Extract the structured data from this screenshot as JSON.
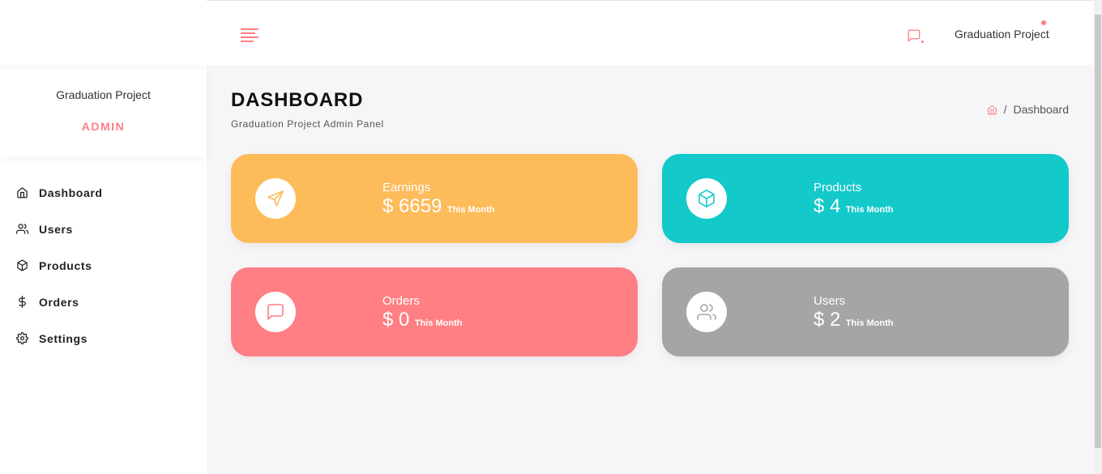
{
  "sidebar": {
    "profile_name": "Graduation Project",
    "profile_role": "ADMIN",
    "items": [
      {
        "label": "Dashboard",
        "icon": "home-icon"
      },
      {
        "label": "Users",
        "icon": "users-icon"
      },
      {
        "label": "Products",
        "icon": "box-icon"
      },
      {
        "label": "Orders",
        "icon": "dollar-icon"
      },
      {
        "label": "Settings",
        "icon": "gear-icon"
      }
    ]
  },
  "header": {
    "menu_icon": "menu-lines-icon",
    "message_icon": "message-icon",
    "user_name": "Graduation Project"
  },
  "page": {
    "title": "DASHBOARD",
    "subtitle": "Graduation Project Admin Panel",
    "breadcrumb_current": "Dashboard",
    "breadcrumb_separator": "/"
  },
  "cards": [
    {
      "label": "Earnings",
      "amount": "$ 6659",
      "period": "This Month",
      "color": "#fdbb5a",
      "icon": "send-icon"
    },
    {
      "label": "Products",
      "amount": "$ 4",
      "period": "This Month",
      "color": "#13c9ca",
      "icon": "box-icon"
    },
    {
      "label": "Orders",
      "amount": "$ 0",
      "period": "This Month",
      "color": "#ff7f84",
      "icon": "message-icon"
    },
    {
      "label": "Users",
      "amount": "$ 2",
      "period": "This Month",
      "color": "#a5a5a5",
      "icon": "users-icon"
    }
  ],
  "colors": {
    "accent": "#ff7f84",
    "background": "#f6f6f8"
  }
}
